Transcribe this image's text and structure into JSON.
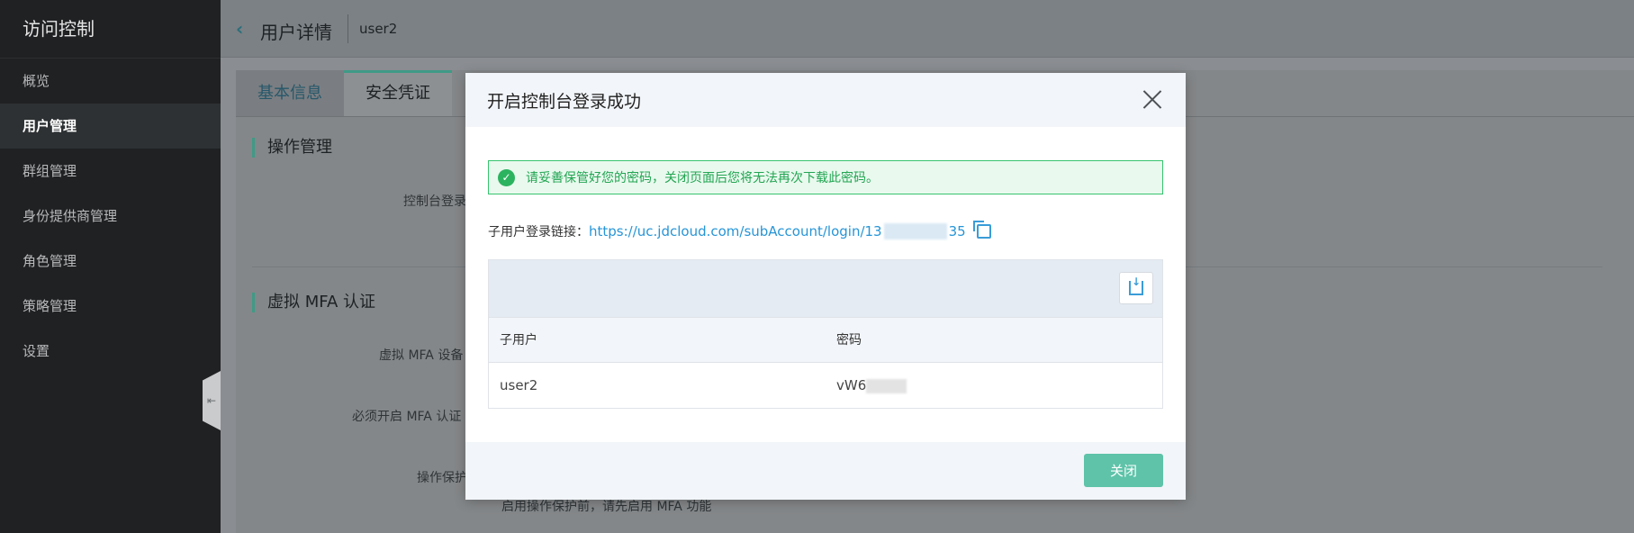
{
  "sidebar": {
    "title": "访问控制",
    "items": [
      {
        "label": "概览"
      },
      {
        "label": "用户管理"
      },
      {
        "label": "群组管理"
      },
      {
        "label": "身份提供商管理"
      },
      {
        "label": "角色管理"
      },
      {
        "label": "策略管理"
      },
      {
        "label": "设置"
      }
    ],
    "active_index": 1
  },
  "header": {
    "title": "用户详情",
    "user": "user2"
  },
  "tabs": [
    {
      "label": "基本信息"
    },
    {
      "label": "安全凭证"
    }
  ],
  "background": {
    "section1_title": "操作管理",
    "label_console": "控制台登录",
    "section2_title": "虚拟 MFA 认证",
    "label_mfa_device": "虚拟 MFA 设备",
    "label_require_mfa": "必须开启 MFA 认证",
    "label_op_protect": "操作保护",
    "hint": "启用操作保护前，请先启用 MFA 功能"
  },
  "modal": {
    "title": "开启控制台登录成功",
    "alert": "请妥善保管好您的密码，关闭页面后您将无法再次下载此密码。",
    "link_label": "子用户登录链接：",
    "link_prefix": "https://uc.jdcloud.com/subAccount/login/13",
    "link_suffix": "35",
    "table": {
      "headers": [
        "子用户",
        "密码"
      ],
      "rows": [
        {
          "user": "user2",
          "password": "vW6"
        }
      ]
    },
    "close_label": "关闭"
  },
  "colors": {
    "accent": "#3f9a86",
    "link": "#2795d6",
    "success": "#2cb35f",
    "primary_button": "#5ec3a9"
  }
}
